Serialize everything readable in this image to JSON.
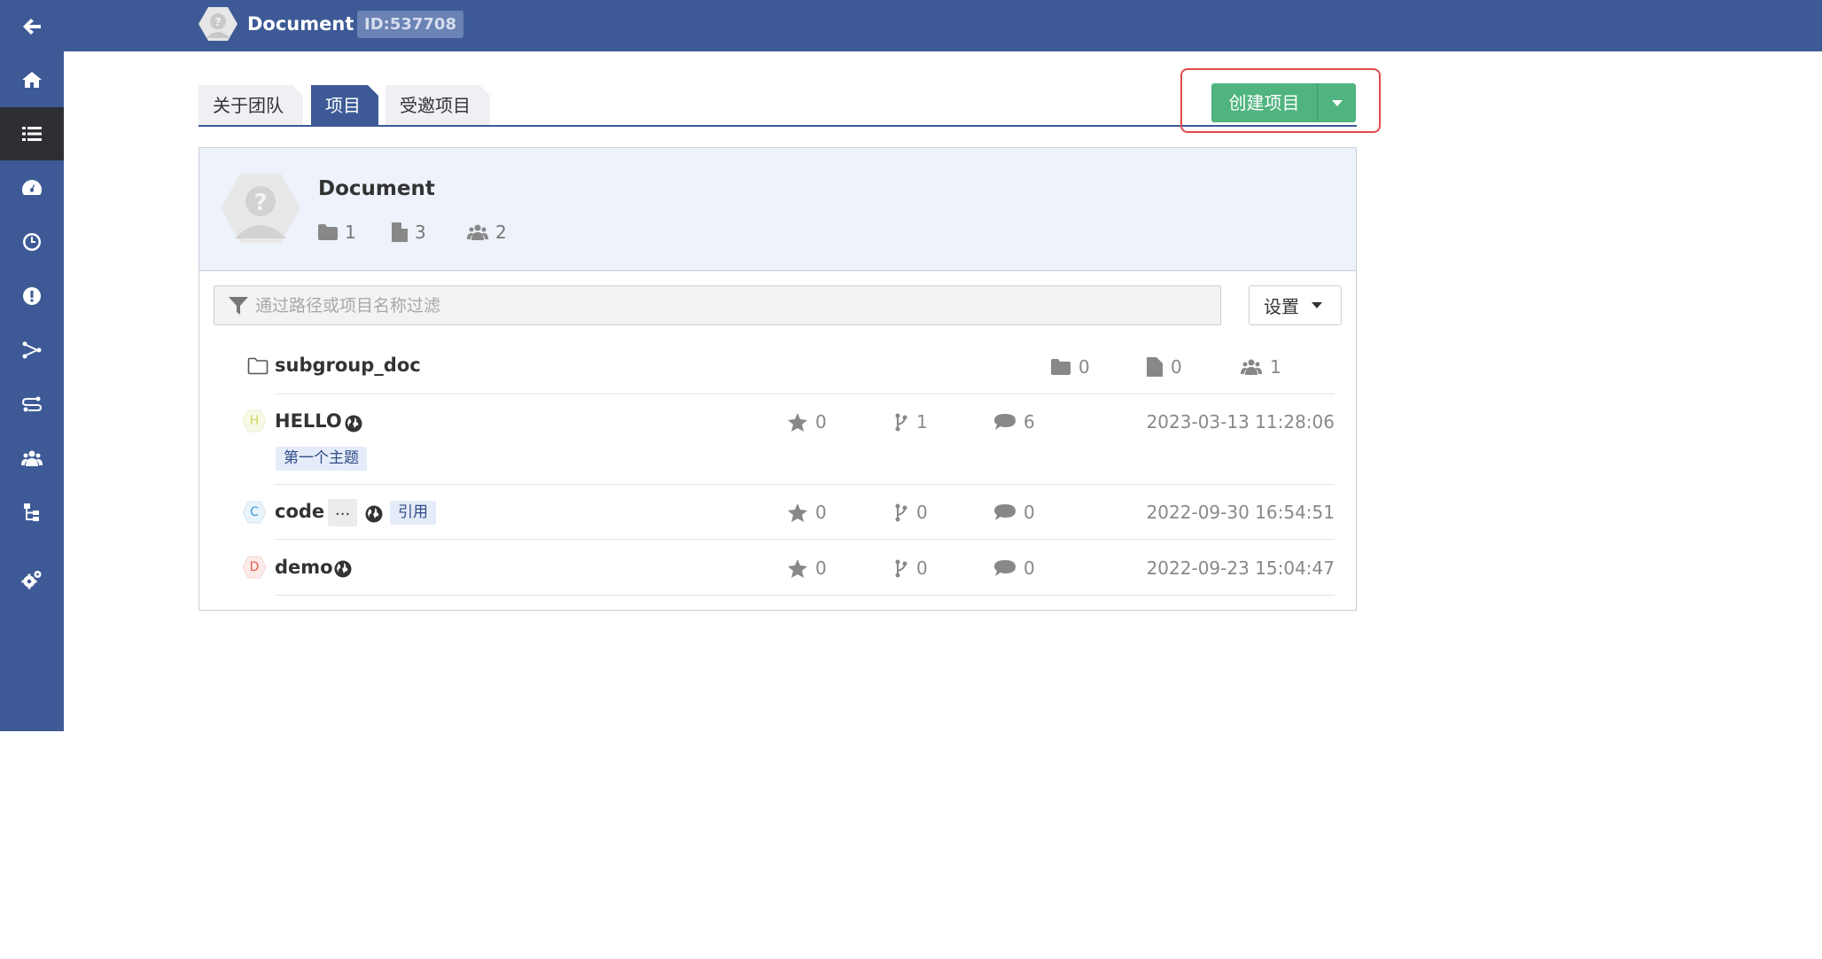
{
  "sidebar": {
    "icons": [
      "back-arrow-icon",
      "home-icon",
      "list-icon",
      "dashboard-icon",
      "clock-icon",
      "alert-icon",
      "merge-icon",
      "route-icon",
      "users-icon",
      "tree-icon",
      "gears-icon"
    ],
    "active": "list-icon"
  },
  "header": {
    "title": "Document",
    "id_badge": "ID:537708"
  },
  "tabs": [
    {
      "label": "关于团队",
      "active": false
    },
    {
      "label": "项目",
      "active": true
    },
    {
      "label": "受邀项目",
      "active": false
    }
  ],
  "actions": {
    "create_label": "创建项目"
  },
  "group": {
    "name": "Document",
    "folders": "1",
    "docs": "3",
    "members": "2"
  },
  "filter": {
    "placeholder": "通过路径或项目名称过滤",
    "settings_label": "设置"
  },
  "subgroup": {
    "name": "subgroup_doc",
    "folders": "0",
    "docs": "0",
    "members": "1"
  },
  "projects": [
    {
      "initial": "H",
      "name": "HELLO",
      "color": "#cdd85a",
      "stars": "0",
      "forks": "1",
      "comments": "6",
      "updated": "2023-03-13 11:28:06",
      "topic": "第一个主题"
    },
    {
      "initial": "C",
      "name": "code",
      "color": "#3b9ad9",
      "stars": "0",
      "forks": "0",
      "comments": "0",
      "updated": "2022-09-30 16:54:51",
      "more": "...",
      "badge": "引用"
    },
    {
      "initial": "D",
      "name": "demo",
      "color": "#e85a4f",
      "stars": "0",
      "forks": "0",
      "comments": "0",
      "updated": "2022-09-23 15:04:47"
    }
  ],
  "colors": {
    "brand": "#3d5a96",
    "create_button": "#4fb47f",
    "highlight": "#e14b4b"
  }
}
